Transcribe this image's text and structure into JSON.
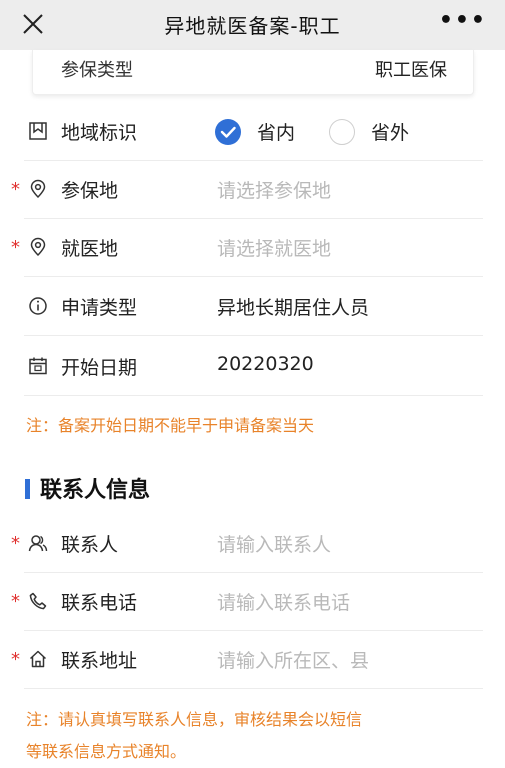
{
  "header": {
    "title": "异地就医备案-职工",
    "more_label": "•••"
  },
  "insurance_type": {
    "label": "参保类型",
    "value": "职工医保"
  },
  "region": {
    "label": "地域标识",
    "options": [
      {
        "label": "省内",
        "selected": true
      },
      {
        "label": "省外",
        "selected": false
      }
    ]
  },
  "insured_place": {
    "required_mark": "*",
    "label": "参保地",
    "placeholder": "请选择参保地"
  },
  "medical_place": {
    "required_mark": "*",
    "label": "就医地",
    "placeholder": "请选择就医地"
  },
  "application_type": {
    "label": "申请类型",
    "value": "异地长期居住人员"
  },
  "start_date": {
    "label": "开始日期",
    "value": "20220320"
  },
  "notice_1": "注：备案开始日期不能早于申请备案当天",
  "contact_section": {
    "title": "联系人信息",
    "contact_person": {
      "required_mark": "*",
      "label": "联系人",
      "placeholder": "请输入联系人"
    },
    "contact_phone": {
      "required_mark": "*",
      "label": "联系电话",
      "placeholder": "请输入联系电话"
    },
    "contact_address": {
      "required_mark": "*",
      "label": "联系地址",
      "placeholder": "请输入所在区、县"
    }
  },
  "notice_2_line1": "注：请认真填写联系人信息，审核结果会以短信",
  "notice_2_line2": "等联系信息方式通知。",
  "colors": {
    "accent": "#2f6fd6",
    "required": "#e0312f",
    "notice": "#e8832a",
    "placeholder": "#b9b9b9"
  }
}
